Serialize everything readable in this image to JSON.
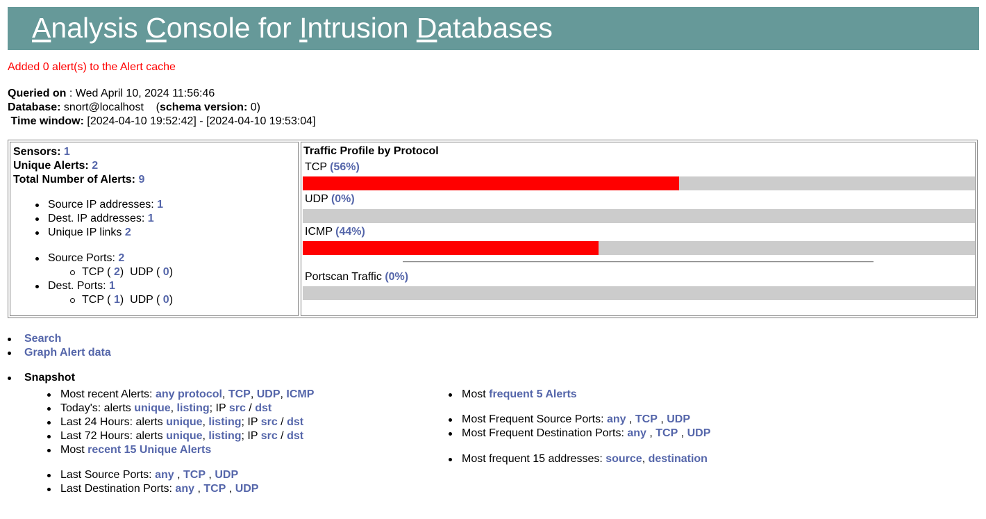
{
  "header": {
    "title_parts": [
      {
        "u": "A",
        "rest": "nalysis "
      },
      {
        "u": "C",
        "rest": "onsole for "
      },
      {
        "u": "I",
        "rest": "ntrusion "
      },
      {
        "u": "D",
        "rest": "atabases"
      }
    ],
    "background": "#669999"
  },
  "message": "Added 0 alert(s) to the Alert cache",
  "meta": {
    "queried_label": "Queried on",
    "queried_value": " : Wed April 10, 2024 11:56:46",
    "database_label": "Database:",
    "database_value": " snort@localhost",
    "schema_label": "schema version:",
    "schema_value": " 0)",
    "time_label": "Time window:",
    "time_value": " [2024-04-10 19:52:42] - [2024-04-10 19:53:04]"
  },
  "stats": {
    "sensors_label": "Sensors:",
    "sensors": "1",
    "unique_alerts_label": "Unique Alerts:",
    "unique_alerts": "2",
    "total_alerts_label": "Total Number of Alerts:",
    "total_alerts": "9",
    "src_ip_label": "Source IP addresses:",
    "src_ip": "1",
    "dst_ip_label": "Dest. IP addresses:",
    "dst_ip": "1",
    "ip_links_label": "Unique IP links",
    "ip_links": "2",
    "src_ports_label": "Source Ports:",
    "src_ports": "2",
    "src_tcp": "2",
    "src_udp": "0",
    "dst_ports_label": "Dest. Ports:",
    "dst_ports": "1",
    "dst_tcp": "1",
    "dst_udp": "0",
    "tcp_label": "TCP (",
    "udp_label": "UDP (",
    "close_paren": ")"
  },
  "traffic": {
    "title": "Traffic Profile by Protocol",
    "protocols": [
      {
        "name": "TCP",
        "pct_text": "(56%)",
        "pct": 56
      },
      {
        "name": "UDP",
        "pct_text": "(0%)",
        "pct": 0
      },
      {
        "name": "ICMP",
        "pct_text": "(44%)",
        "pct": 44
      }
    ],
    "portscan_label": "Portscan Traffic",
    "portscan_pct_text": "(0%)",
    "portscan_pct": 0,
    "fill_color": "#ff0000",
    "track_color": "#cccccc"
  },
  "nav": {
    "search": "Search",
    "graph": "Graph Alert data",
    "snapshot": "Snapshot"
  },
  "snapshot_left": {
    "recent_label": "Most recent Alerts: ",
    "any_protocol": "any protocol",
    "tcp": "TCP",
    "udp": "UDP",
    "icmp": "ICMP",
    "today_label": "Today's: alerts ",
    "last24_label": "Last 24 Hours: alerts ",
    "last72_label": "Last 72 Hours: alerts ",
    "unique": "unique",
    "listing": "listing",
    "ip_text": "; IP ",
    "src": "src",
    "dst": "dst",
    "most_label": "Most ",
    "recent15": "recent 15 Unique Alerts",
    "last_src_ports_label": "Last Source Ports: ",
    "last_dst_ports_label": "Last Destination Ports: ",
    "any": "any"
  },
  "snapshot_right": {
    "most_label": "Most ",
    "frequent5": "frequent 5 Alerts",
    "freq_src_label": "Most Frequent Source Ports: ",
    "freq_dst_label": "Most Frequent Destination Ports: ",
    "any": "any",
    "tcp": "TCP",
    "udp": "UDP",
    "freq15_label": "Most frequent 15 addresses: ",
    "source": "source",
    "destination": "destination"
  }
}
